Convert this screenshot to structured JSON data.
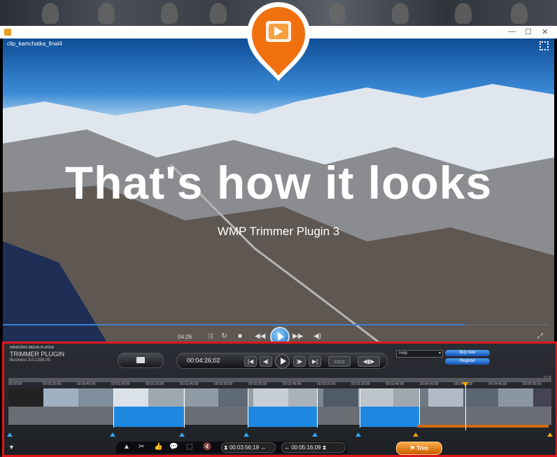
{
  "window": {
    "title": "clip_kamchatka_final4"
  },
  "video": {
    "headline": "That's how it looks",
    "subline": "WMP Trimmer Plugin 3",
    "elapsed": "04:26"
  },
  "plugin": {
    "brand_line1": "WINDOWS MEDIA PLAYER",
    "brand_line2": "TRIMMER PLUGIN",
    "version": "Business 3.0.1308.05",
    "current_time": "00:04:26;02",
    "help_select": "Help",
    "buy_label": "Buy now",
    "register_label": "Register",
    "ruler_ticks": [
      "00:00:00",
      "00:00:20;00",
      "00:00:40;00",
      "00:01:00;00",
      "00:01:20;00",
      "00:01:40;00",
      "00:02:00;00",
      "00:02:20;00",
      "00:02:40;00",
      "00:03:00;00",
      "00:03:20;00",
      "00:03:40;00",
      "00:04:00;00",
      "00:04:20;00",
      "00:04:40;00",
      "00:05:00;00"
    ],
    "start_time": "00:03:56;19",
    "end_time": "00:05:16;09",
    "trim_label": "Trim"
  },
  "colors": {
    "accent_blue": "#1e88e0",
    "highlight_red": "#e0161a",
    "trim_orange": "#e07010",
    "logo_orange": "#f07010"
  }
}
